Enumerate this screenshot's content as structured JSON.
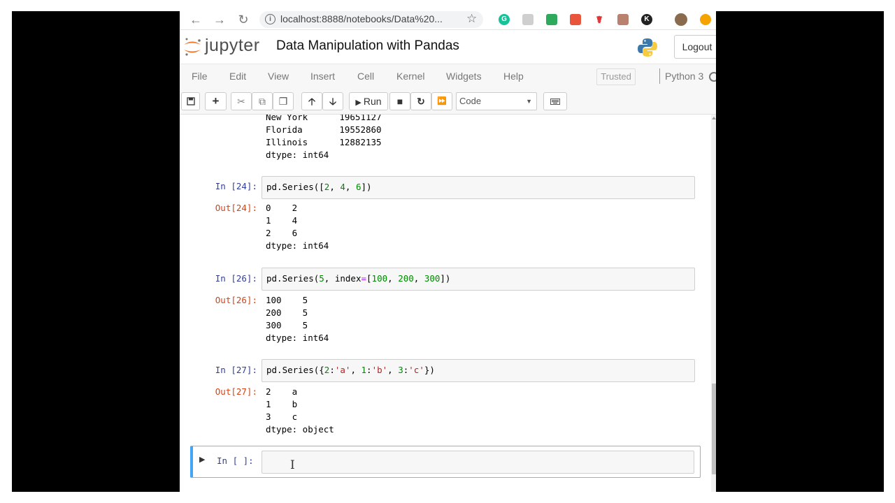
{
  "browser": {
    "url": "localhost:8888/notebooks/Data%20..."
  },
  "header": {
    "logo_text": "jupyter",
    "notebook_title": "Data Manipulation with Pandas",
    "logout_label": "Logout"
  },
  "menu": {
    "items": [
      "File",
      "Edit",
      "View",
      "Insert",
      "Cell",
      "Kernel",
      "Widgets",
      "Help"
    ],
    "trusted": "Trusted",
    "kernel": "Python 3"
  },
  "toolbar": {
    "run_label": "Run",
    "cell_type": "Code"
  },
  "cells": {
    "prev_output": [
      "New York      19651127",
      "Florida       19552860",
      "Illinois      12882135",
      "dtype: int64"
    ],
    "c24": {
      "in_prompt": "In [24]:",
      "out_prompt": "Out[24]:",
      "code": "pd.Series([2, 4, 6])",
      "output": [
        "0    2",
        "1    4",
        "2    6",
        "dtype: int64"
      ]
    },
    "c26": {
      "in_prompt": "In [26]:",
      "out_prompt": "Out[26]:",
      "code": "pd.Series(5, index=[100, 200, 300])",
      "output": [
        "100    5",
        "200    5",
        "300    5",
        "dtype: int64"
      ]
    },
    "c27": {
      "in_prompt": "In [27]:",
      "out_prompt": "Out[27]:",
      "code": "pd.Series({2:'a', 1:'b', 3:'c'})",
      "output": [
        "2    a",
        "1    b",
        "3    c",
        "dtype: object"
      ]
    },
    "empty": {
      "in_prompt": "In [ ]:"
    }
  }
}
